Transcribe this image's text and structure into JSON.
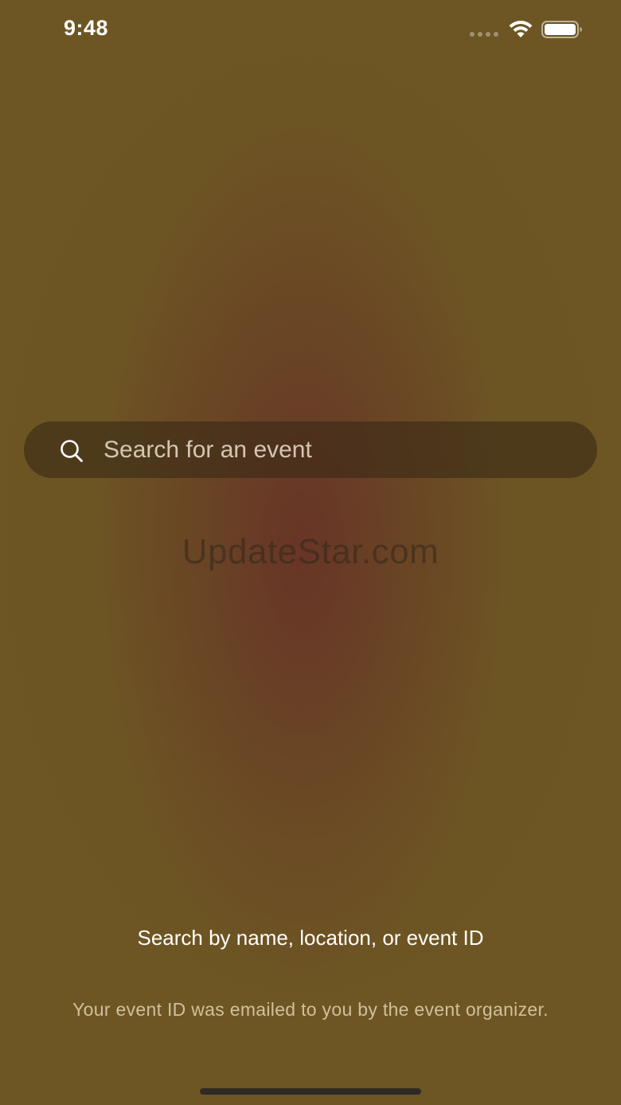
{
  "status_bar": {
    "time": "9:48",
    "icons": [
      "cellular-dots-icon",
      "wifi-icon",
      "battery-icon"
    ]
  },
  "search": {
    "placeholder": "Search for an event",
    "value": "",
    "icon": "search-icon"
  },
  "watermark": "UpdateStar.com",
  "hint": {
    "title": "Search by name, location, or event ID",
    "subtitle": "Your event ID was emailed to you by the event organizer."
  },
  "colors": {
    "background": "#6d5623",
    "center_glow": "#683426",
    "search_bg": "#3a2a16",
    "text_primary": "#ffffff",
    "text_secondary": "#e1d2b4"
  }
}
